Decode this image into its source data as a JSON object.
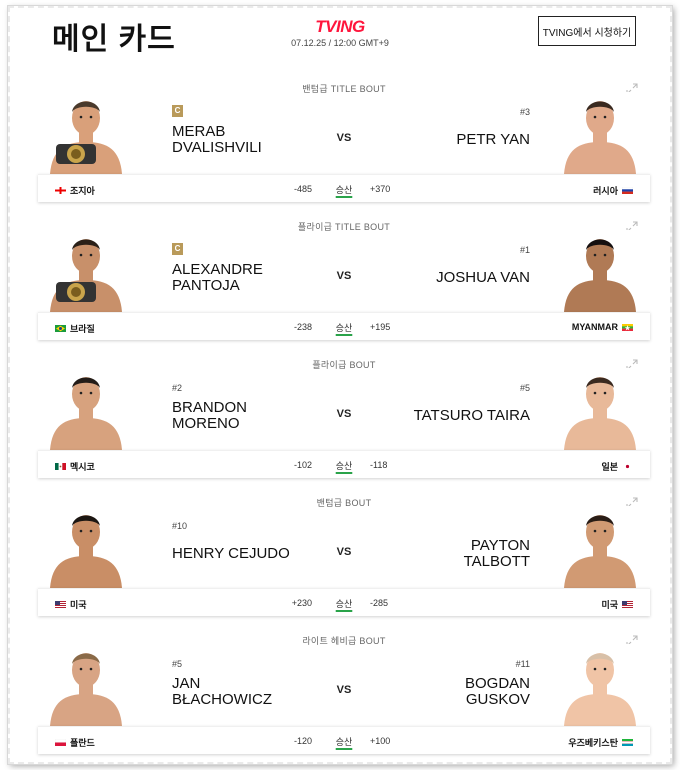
{
  "header": {
    "title": "메인 카드",
    "brand": "TVING",
    "event_time": "07.12.25 / 12:00 GMT+9",
    "watch_button": "TVING에서 시청하기"
  },
  "win_label": "승산",
  "vs_label": "VS",
  "bouts": [
    {
      "label": "밴텀급 TITLE BOUT",
      "left": {
        "name": [
          "MERAB",
          "DVALISHVILI"
        ],
        "rank": "C",
        "champion": true,
        "country": "조지아",
        "odds": "-485",
        "flag": "georgia"
      },
      "right": {
        "name": [
          "PETR YAN"
        ],
        "rank": "#3",
        "champion": false,
        "country": "러시아",
        "odds": "+370",
        "flag": "russia"
      }
    },
    {
      "label": "플라이급 TITLE BOUT",
      "left": {
        "name": [
          "ALEXANDRE",
          "PANTOJA"
        ],
        "rank": "C",
        "champion": true,
        "country": "브라질",
        "odds": "-238",
        "flag": "brazil"
      },
      "right": {
        "name": [
          "JOSHUA VAN"
        ],
        "rank": "#1",
        "champion": false,
        "country": "MYANMAR",
        "odds": "+195",
        "flag": "myanmar"
      }
    },
    {
      "label": "플라이급 BOUT",
      "left": {
        "name": [
          "BRANDON",
          "MORENO"
        ],
        "rank": "#2",
        "champion": false,
        "country": "멕시코",
        "odds": "-102",
        "flag": "mexico"
      },
      "right": {
        "name": [
          "TATSURO TAIRA"
        ],
        "rank": "#5",
        "champion": false,
        "country": "일본",
        "odds": "-118",
        "flag": "japan"
      }
    },
    {
      "label": "밴텀급 BOUT",
      "left": {
        "name": [
          "HENRY CEJUDO"
        ],
        "rank": "#10",
        "champion": false,
        "country": "미국",
        "odds": "+230",
        "flag": "usa"
      },
      "right": {
        "name": [
          "PAYTON",
          "TALBOTT"
        ],
        "rank": "",
        "champion": false,
        "country": "미국",
        "odds": "-285",
        "flag": "usa"
      }
    },
    {
      "label": "라이트 헤비급 BOUT",
      "left": {
        "name": [
          "JAN",
          "BŁACHOWICZ"
        ],
        "rank": "#5",
        "champion": false,
        "country": "폴란드",
        "odds": "-120",
        "flag": "poland"
      },
      "right": {
        "name": [
          "BOGDAN",
          "GUSKOV"
        ],
        "rank": "#11",
        "champion": false,
        "country": "우즈베키스탄",
        "odds": "+100",
        "flag": "uzbekistan"
      }
    }
  ],
  "colors": {
    "brand": "#ff153c",
    "champion_badge": "#b99a5a",
    "win_underline": "#2aa34a"
  }
}
